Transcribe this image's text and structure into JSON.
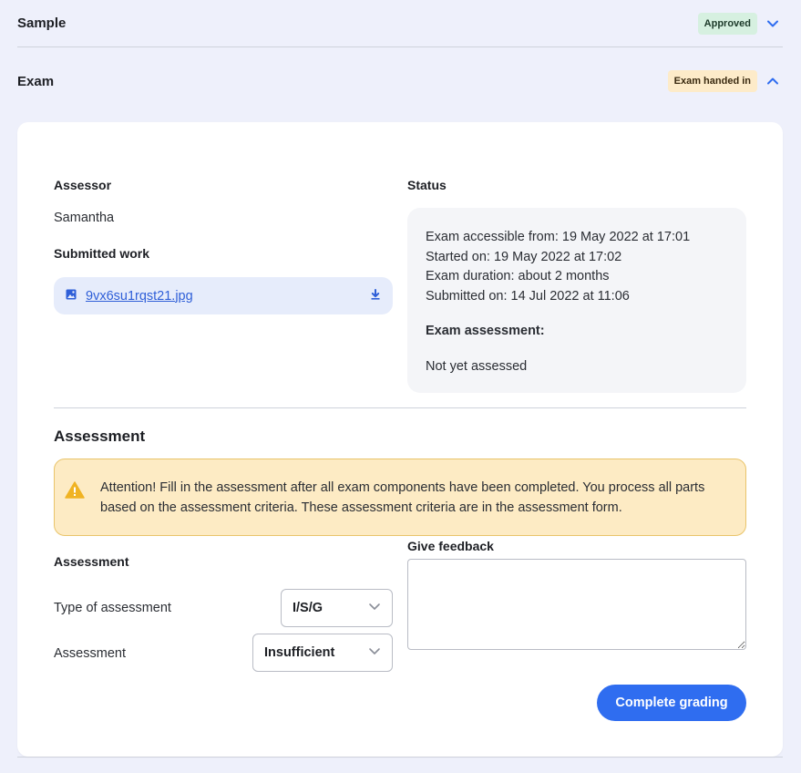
{
  "sections": {
    "sample": {
      "title": "Sample",
      "badge": "Approved",
      "chevron": "chevron-down-icon"
    },
    "exam": {
      "title": "Exam",
      "badge": "Exam handed in",
      "chevron": "chevron-up-icon"
    }
  },
  "details": {
    "assessor_label": "Assessor",
    "assessor_name": "Samantha",
    "submitted_work_label": "Submitted work",
    "file_name": "9vx6su1rqst21.jpg",
    "file_icon": "image-icon",
    "download_icon": "download-icon"
  },
  "status": {
    "label": "Status",
    "accessible_from": "Exam accessible from: 19 May 2022 at 17:01",
    "started_on": "Started on: 19 May 2022 at 17:02",
    "duration": "Exam duration: about 2 months",
    "submitted_on": "Submitted on: 14 Jul 2022 at 11:06",
    "assessment_heading": "Exam assessment:",
    "assessment_value": "Not yet assessed"
  },
  "assessment": {
    "title": "Assessment",
    "alert_text": "Attention! Fill in the assessment after all exam components have been completed. You process all parts based on the assessment criteria. These assessment criteria are in the assessment form.",
    "form_heading": "Assessment",
    "type_label": "Type of assessment",
    "type_value": "I/S/G",
    "assessment_label": "Assessment",
    "assessment_value": "Insufficient",
    "feedback_label": "Give feedback",
    "feedback_value": "",
    "submit_label": "Complete grading"
  },
  "colors": {
    "accent": "#2f6df0",
    "approved_bg": "#d6f0e0",
    "handed_in_bg": "#fdebc9",
    "alert_bg": "#fdebc4",
    "alert_icon": "#f0b323"
  }
}
